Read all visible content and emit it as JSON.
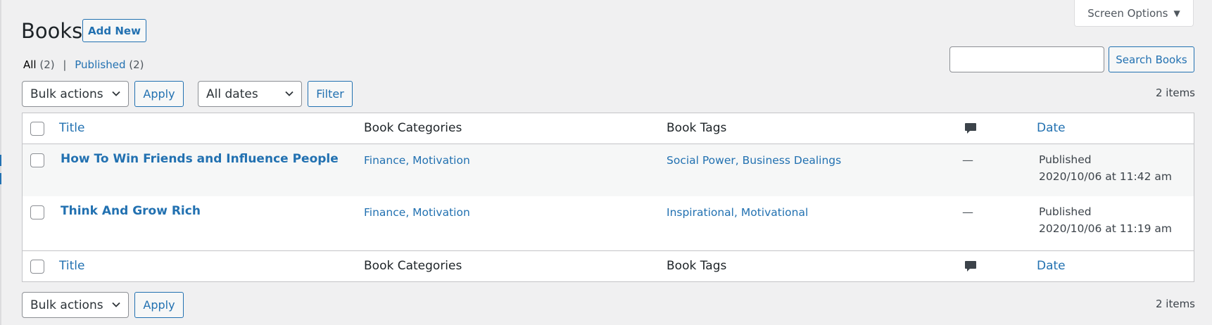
{
  "header": {
    "title": "Books",
    "add_new_label": "Add New",
    "screen_options_label": "Screen Options"
  },
  "views": {
    "all_label": "All",
    "all_count": "(2)",
    "separator": "|",
    "published_label": "Published",
    "published_count": "(2)"
  },
  "search": {
    "value": "",
    "button_label": "Search Books"
  },
  "tablenav_top": {
    "bulk_actions_selected": "Bulk actions",
    "apply_label": "Apply",
    "dates_selected": "All dates",
    "filter_label": "Filter",
    "items_count": "2 items"
  },
  "tablenav_bottom": {
    "bulk_actions_selected": "Bulk actions",
    "apply_label": "Apply",
    "items_count": "2 items"
  },
  "columns": {
    "title": "Title",
    "categories": "Book Categories",
    "tags": "Book Tags",
    "comments_icon": "comment-icon",
    "date": "Date"
  },
  "rows": [
    {
      "title": "How To Win Friends and Influence People",
      "categories": [
        "Finance",
        "Motivation"
      ],
      "tags": [
        "Social Power",
        "Business Dealings"
      ],
      "comments": "—",
      "status": "Published",
      "date": "2020/10/06 at 11:42 am"
    },
    {
      "title": "Think And Grow Rich",
      "categories": [
        "Finance",
        "Motivation"
      ],
      "tags": [
        "Inspirational",
        "Motivational"
      ],
      "comments": "—",
      "status": "Published",
      "date": "2020/10/06 at 11:19 am"
    }
  ],
  "colors": {
    "accent": "#2271b1",
    "background": "#f0f0f1",
    "text": "#1d2327"
  }
}
